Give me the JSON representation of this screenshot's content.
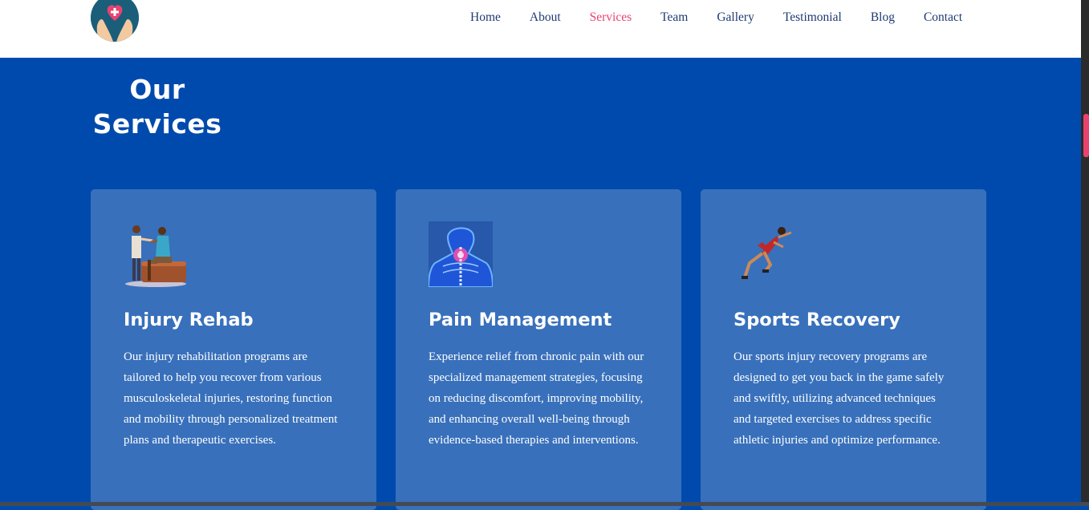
{
  "header": {
    "nav": [
      {
        "label": "Home"
      },
      {
        "label": "About"
      },
      {
        "label": "Services",
        "active": true
      },
      {
        "label": "Team"
      },
      {
        "label": "Gallery"
      },
      {
        "label": "Testimonial"
      },
      {
        "label": "Blog"
      },
      {
        "label": "Contact"
      }
    ],
    "logo_icon": "heart-hands-icon"
  },
  "hero": {
    "title_line1": "Our",
    "title_line2": "Services"
  },
  "services": [
    {
      "title": "Injury Rehab",
      "icon": "rehab-therapist-icon",
      "description": "Our injury rehabilitation programs are tailored to help you recover from various musculoskeletal injuries, restoring function and mobility through personalized treatment plans and therapeutic exercises."
    },
    {
      "title": "Pain Management",
      "icon": "spine-xray-icon",
      "description": "Experience relief from chronic pain with our specialized management strategies, focusing on reducing discomfort, improving mobility, and enhancing overall well-being through evidence-based therapies and interventions."
    },
    {
      "title": "Sports Recovery",
      "icon": "sprinter-icon",
      "description": "Our sports injury recovery programs are designed to get you back in the game safely and swiftly, utilizing advanced techniques and targeted exercises to address specific athletic injuries and optimize performance."
    }
  ],
  "colors": {
    "background": "#004aad",
    "card": "#3870bb",
    "nav_text": "#1d3b73",
    "accent": "#e8436f"
  }
}
